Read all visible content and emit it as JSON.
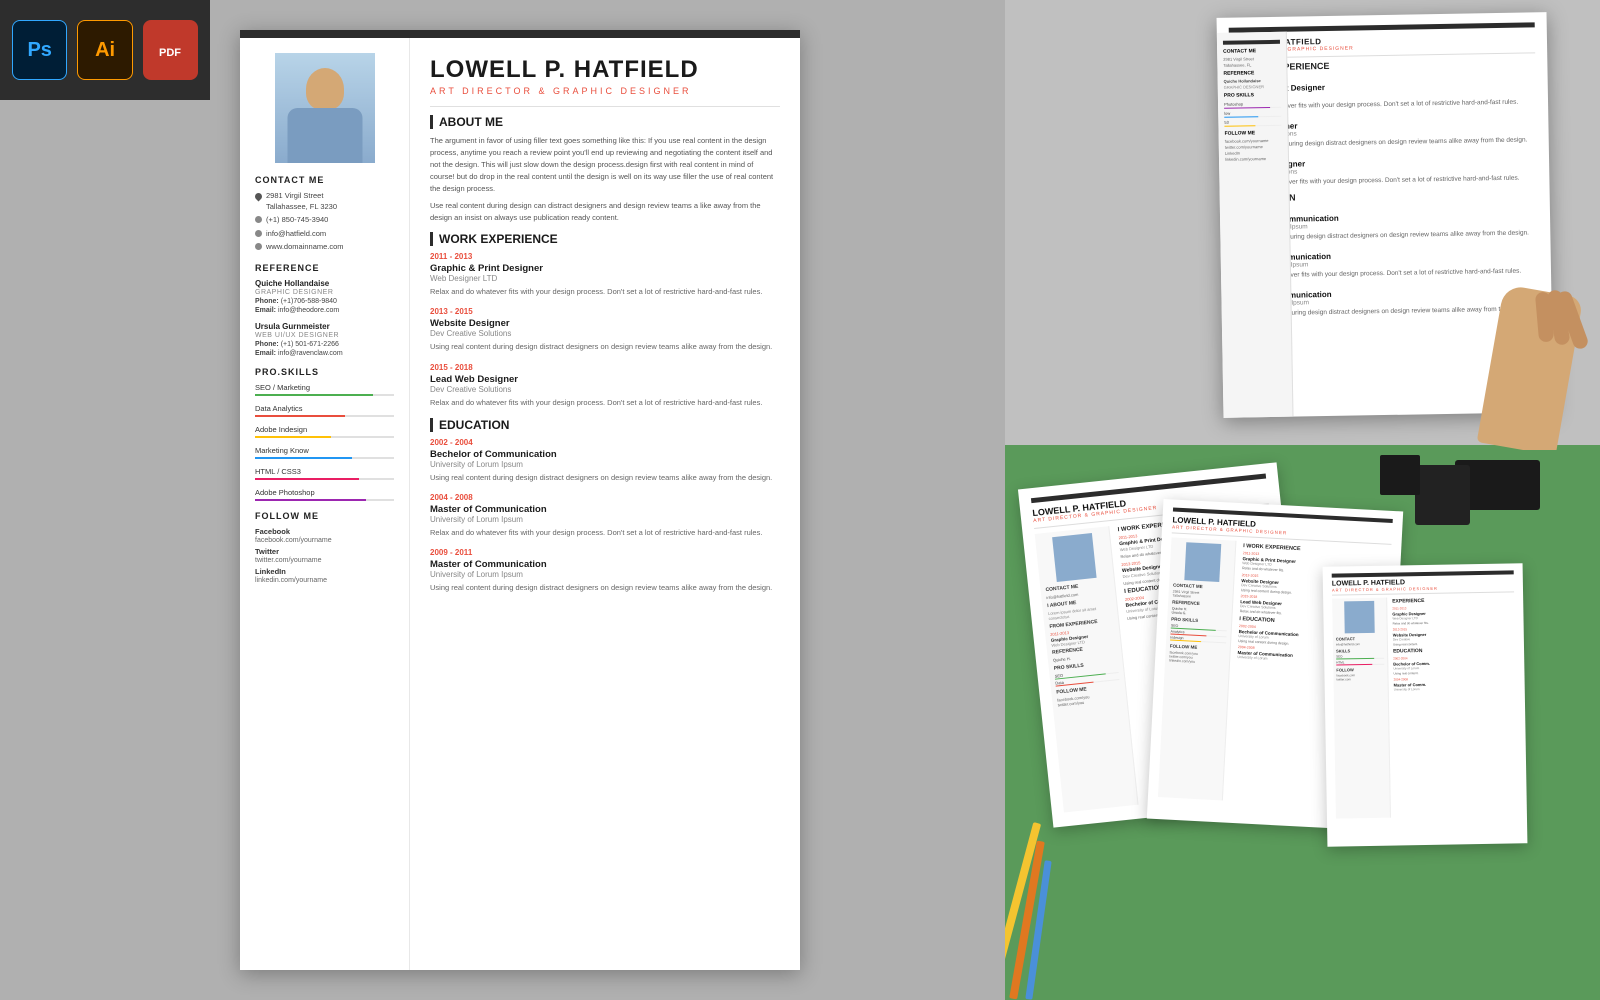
{
  "toolbar": {
    "tools": [
      {
        "id": "ps",
        "label": "Ps",
        "type": "photoshop"
      },
      {
        "id": "ai",
        "label": "Ai",
        "type": "illustrator"
      },
      {
        "id": "pdf",
        "label": "PDF",
        "type": "pdf"
      }
    ]
  },
  "resume": {
    "name": "LOWELL P. HATFIELD",
    "title": "ART DIRECTOR & GRAPHIC DESIGNER",
    "contact": {
      "heading": "CONTACT ME",
      "address": "2981 Virgil Street\nTallahassee, FL 3230",
      "phone": "(+1) 850-745-3940",
      "email": "info@hatfield.com",
      "website": "www.domainname.com"
    },
    "reference": {
      "heading": "REFERENCE",
      "refs": [
        {
          "name": "Quiche Hollandaise",
          "role": "GRAPHIC DESIGNER",
          "phone": "(+1)706-588-9840",
          "email": "info@theodore.com"
        },
        {
          "name": "Ursula Gurnmeister",
          "role": "WEB UI/UX DESIGNER",
          "phone": "(+1) 501-671-2266",
          "email": "info@ravenclaw.com"
        }
      ]
    },
    "skills": {
      "heading": "PRO.SKILLS",
      "items": [
        {
          "name": "SEO / Marketing",
          "percent": 85,
          "color": "#4caf50"
        },
        {
          "name": "Data Analytics",
          "percent": 65,
          "color": "#e94e3d"
        },
        {
          "name": "Adobe Indesign",
          "percent": 55,
          "color": "#ffc107"
        },
        {
          "name": "Marketing Know",
          "percent": 70,
          "color": "#2196f3"
        },
        {
          "name": "HTML / CSS3",
          "percent": 75,
          "color": "#e91e63"
        },
        {
          "name": "Adobe Photoshop",
          "percent": 80,
          "color": "#9c27b0"
        }
      ]
    },
    "follow": {
      "heading": "FOLLOW ME",
      "items": [
        {
          "platform": "Facebook",
          "url": "facebook.com/yourname"
        },
        {
          "platform": "Twitter",
          "url": "twitter.com/yourname"
        },
        {
          "platform": "LinkedIn",
          "url": "linkedin.com/yourname"
        }
      ]
    },
    "about": {
      "heading": "ABOUT ME",
      "text1": "The argument in favor of using filler text goes something like this: If you use real content in the design process, anytime you reach a review point you'll end up reviewing and negotiating the content itself and not the design. This will just slow down the design process.design first with real content in mind of course! but do drop in the real content until the design is well on its way use filler the use of real content the design process.",
      "text2": "Use real content during design can distract designers and design review teams a like away from the design an insist on always use publication ready content."
    },
    "work": {
      "heading": "WORK EXPERIENCE",
      "items": [
        {
          "years": "2011 - 2013",
          "role": "Graphic & Print Designer",
          "company": "Web Designer LTD",
          "desc": "Relax and do whatever fits with your design process. Don't set a lot of restrictive hard-and-fast rules."
        },
        {
          "years": "2013 - 2015",
          "role": "Website Designer",
          "company": "Dev Creative Solutions",
          "desc": "Using real content during design distract designers on design review teams alike away from the design."
        },
        {
          "years": "2015 - 2018",
          "role": "Lead Web Designer",
          "company": "Dev Creative Solutions",
          "desc": "Relax and do whatever fits with your design process. Don't set a lot of restrictive hard-and-fast rules."
        }
      ]
    },
    "education": {
      "heading": "EDUCATION",
      "items": [
        {
          "years": "2002 - 2004",
          "degree": "Bechelor of Communication",
          "school": "University of Lorum Ipsum",
          "desc": "Using real content during design distract designers on design review teams alike away from the design."
        },
        {
          "years": "2004 - 2008",
          "degree": "Master of Communication",
          "school": "University of Lorum Ipsum",
          "desc": "Relax and do whatever fits with your design process. Don't set a lot of restrictive hard-and-fast rules."
        },
        {
          "years": "2009 - 2011",
          "degree": "Master of Communication",
          "school": "University of Lorum Ipsum",
          "desc": "Using real content during design distract designers on design review teams alike away from the design."
        }
      ]
    }
  }
}
